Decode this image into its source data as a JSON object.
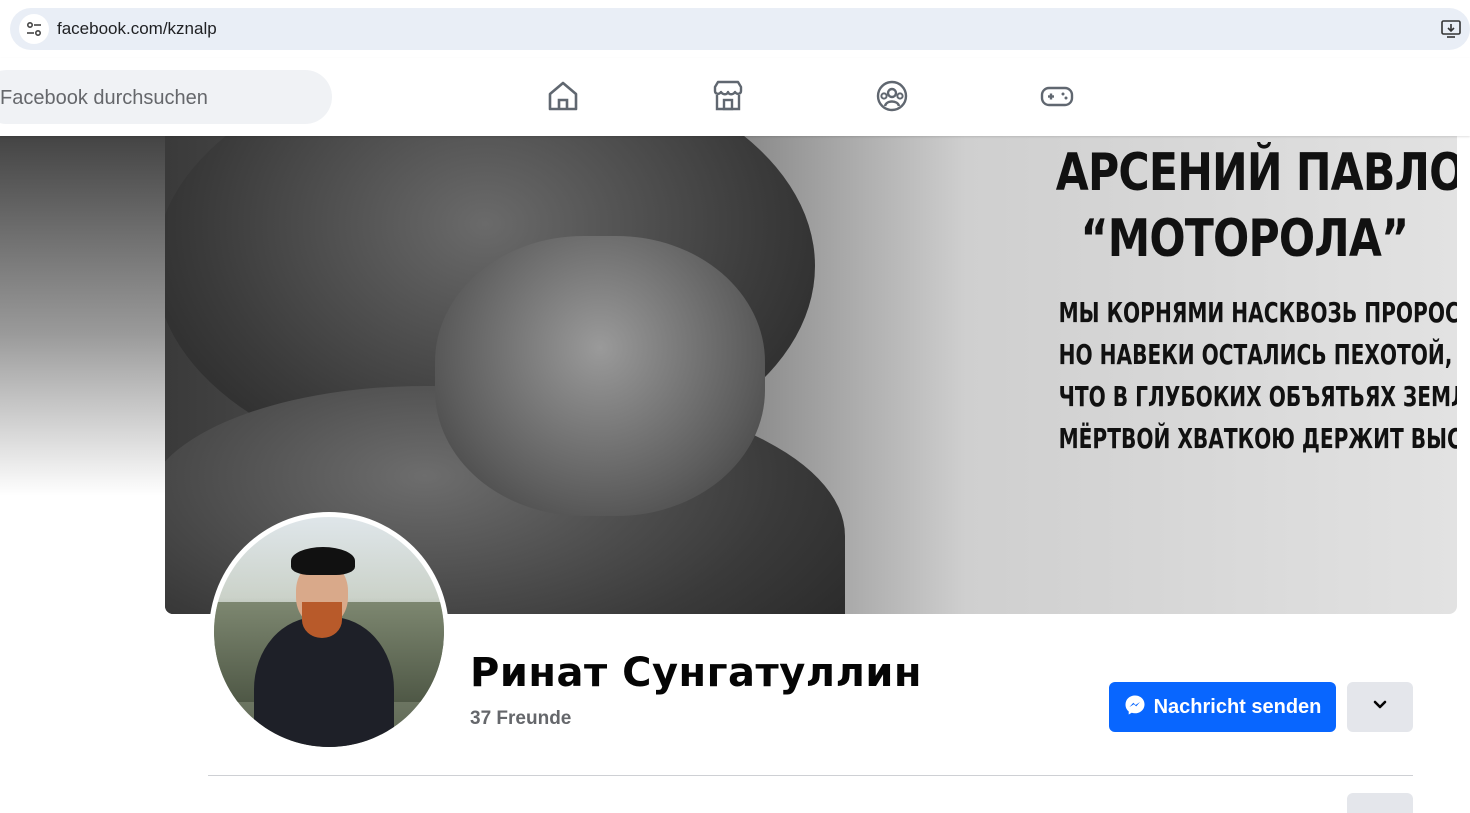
{
  "browser": {
    "url": "facebook.com/kznalp"
  },
  "nav": {
    "search_placeholder": "Facebook durchsuchen",
    "icons": [
      "home-icon",
      "marketplace-icon",
      "groups-icon",
      "gaming-icon"
    ]
  },
  "cover": {
    "title_line1": "АРСЕНИЙ ПАВЛОВ",
    "title_line2": "“МОТОРОЛА”",
    "poem": [
      "МЫ КОРНЯМИ НАСКВОЗЬ ПРОРОСЛИ,",
      "НО НАВЕКИ ОСТАЛИСЬ ПЕХОТОЙ,",
      "ЧТО В ГЛУБОКИХ ОБЪЯТЬЯХ ЗЕМЛИ",
      "МЁРТВОЙ ХВАТКОЮ ДЕРЖИТ ВЫСОТЫ."
    ]
  },
  "profile": {
    "name": "Ринат Сунгатуллин",
    "friends": "37 Freunde"
  },
  "actions": {
    "message_label": "Nachricht senden"
  },
  "colors": {
    "primary": "#0866ff",
    "secondary_button": "#e4e6eb",
    "text_muted": "#65676b"
  }
}
